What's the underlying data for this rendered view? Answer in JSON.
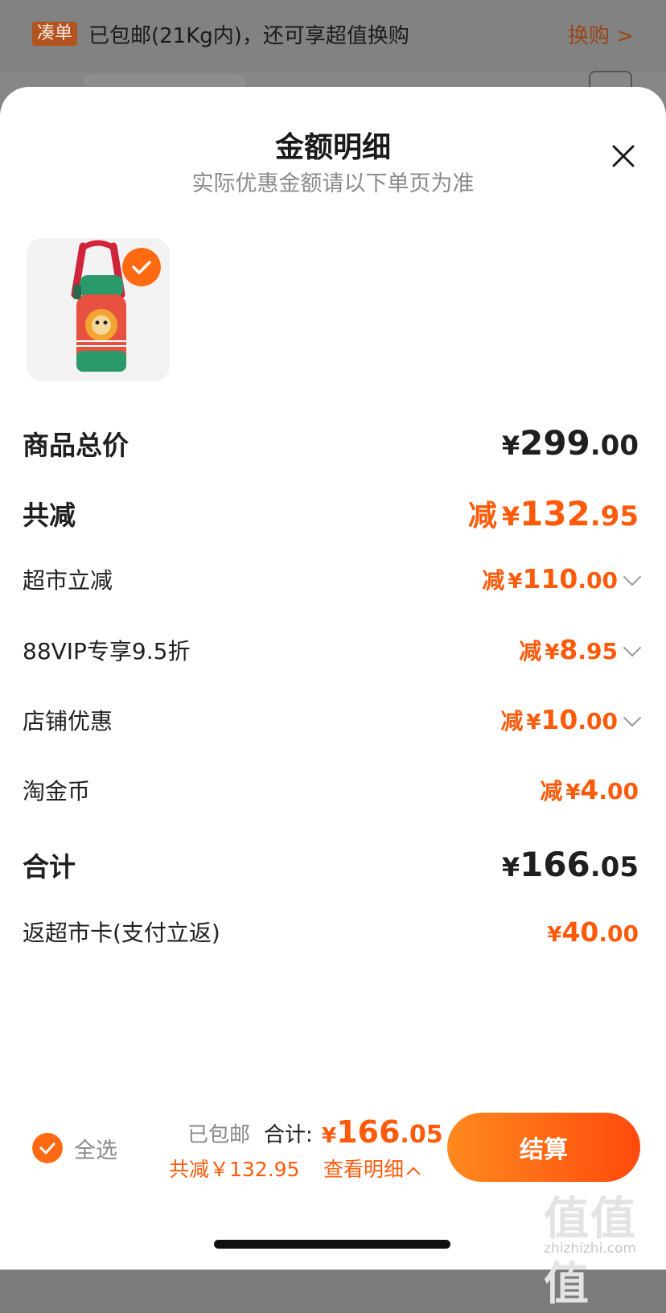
{
  "background": {
    "tag": "凑单",
    "text": "已包邮(21Kg内)，还可享超值换购",
    "link": "换购 >"
  },
  "sheet": {
    "title": "金额明细",
    "subtitle": "实际优惠金额请以下单页为准"
  },
  "summary": {
    "total_price": {
      "label": "商品总价",
      "prefix": "",
      "symbol": "¥",
      "int": "299",
      "dec": ".00"
    },
    "total_discount": {
      "label": "共减",
      "prefix": "减",
      "symbol": "¥",
      "int": "132",
      "dec": ".95"
    },
    "items": [
      {
        "label": "超市立减",
        "prefix": "减",
        "symbol": "¥",
        "int": "110",
        "dec": ".00",
        "expandable": true
      },
      {
        "label": "88VIP专享9.5折",
        "prefix": "减",
        "symbol": "¥",
        "int": "8",
        "dec": ".95",
        "expandable": true
      },
      {
        "label": "店铺优惠",
        "prefix": "减",
        "symbol": "¥",
        "int": "10",
        "dec": ".00",
        "expandable": true
      },
      {
        "label": "淘金币",
        "prefix": "减",
        "symbol": "¥",
        "int": "4",
        "dec": ".00",
        "expandable": false
      }
    ],
    "grand_total": {
      "label": "合计",
      "symbol": "¥",
      "int": "166",
      "dec": ".05"
    },
    "rebate": {
      "label": "返超市卡(支付立返)",
      "symbol": "¥",
      "int": "40",
      "dec": ".00"
    }
  },
  "footer": {
    "select_all": "全选",
    "shipping": "已包邮",
    "total_label": "合计:",
    "total_symbol": "¥",
    "total_int": "166",
    "total_dec": ".05",
    "saved": "共减￥132.95",
    "detail_link": "查看明细",
    "checkout": "结算"
  },
  "watermark": {
    "logo": "值值值",
    "site": "zhizhizhi.com"
  },
  "colors": {
    "accent": "#ff5a0a",
    "checkout_start": "#ff8a1f",
    "checkout_end": "#ff4a0c"
  }
}
